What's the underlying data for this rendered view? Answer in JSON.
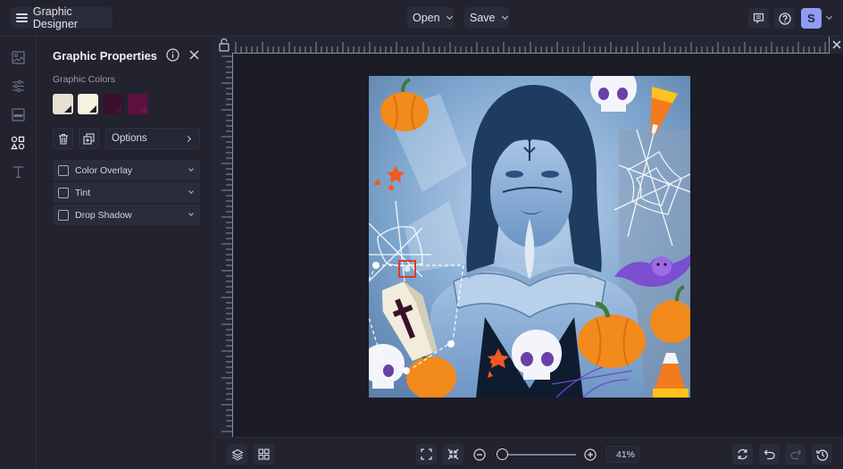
{
  "topbar": {
    "app_title": "Graphic Designer",
    "open_label": "Open",
    "save_label": "Save",
    "avatar_initial": "S",
    "icons": [
      "menu-icon",
      "feedback-icon",
      "help-icon",
      "chevron-down-icon"
    ]
  },
  "rail": {
    "items": [
      {
        "name": "image",
        "icon": "image-icon"
      },
      {
        "name": "adjust",
        "icon": "sliders-icon"
      },
      {
        "name": "frames",
        "icon": "layout-icon"
      },
      {
        "name": "graphics",
        "icon": "shapes-icon",
        "active": true
      },
      {
        "name": "text",
        "icon": "text-icon"
      }
    ]
  },
  "panel": {
    "title": "Graphic Properties",
    "colors_label": "Graphic Colors",
    "swatches": [
      "#e5e1d0",
      "#f7f3e0",
      "#3a0f2c",
      "#5b1040"
    ],
    "options_label": "Options",
    "accordions": [
      {
        "label": "Color Overlay",
        "checked": false
      },
      {
        "label": "Tint",
        "checked": false
      },
      {
        "label": "Drop Shadow",
        "checked": false
      }
    ]
  },
  "canvas": {
    "description": "Halloween themed photo: woman with blue tint holding an open book, surrounded by pumpkins, skulls, candy corn, spider webs, a bat and a selected coffin graphic",
    "selected_element": "coffin graphic"
  },
  "bottombar": {
    "zoom_value": "41%",
    "zoom_fraction": 0.41
  },
  "colors": {
    "accent": "#8f9bf5",
    "background": "#1c1d27",
    "panel": "#22232f",
    "selection_marker": "#e03a2e"
  }
}
